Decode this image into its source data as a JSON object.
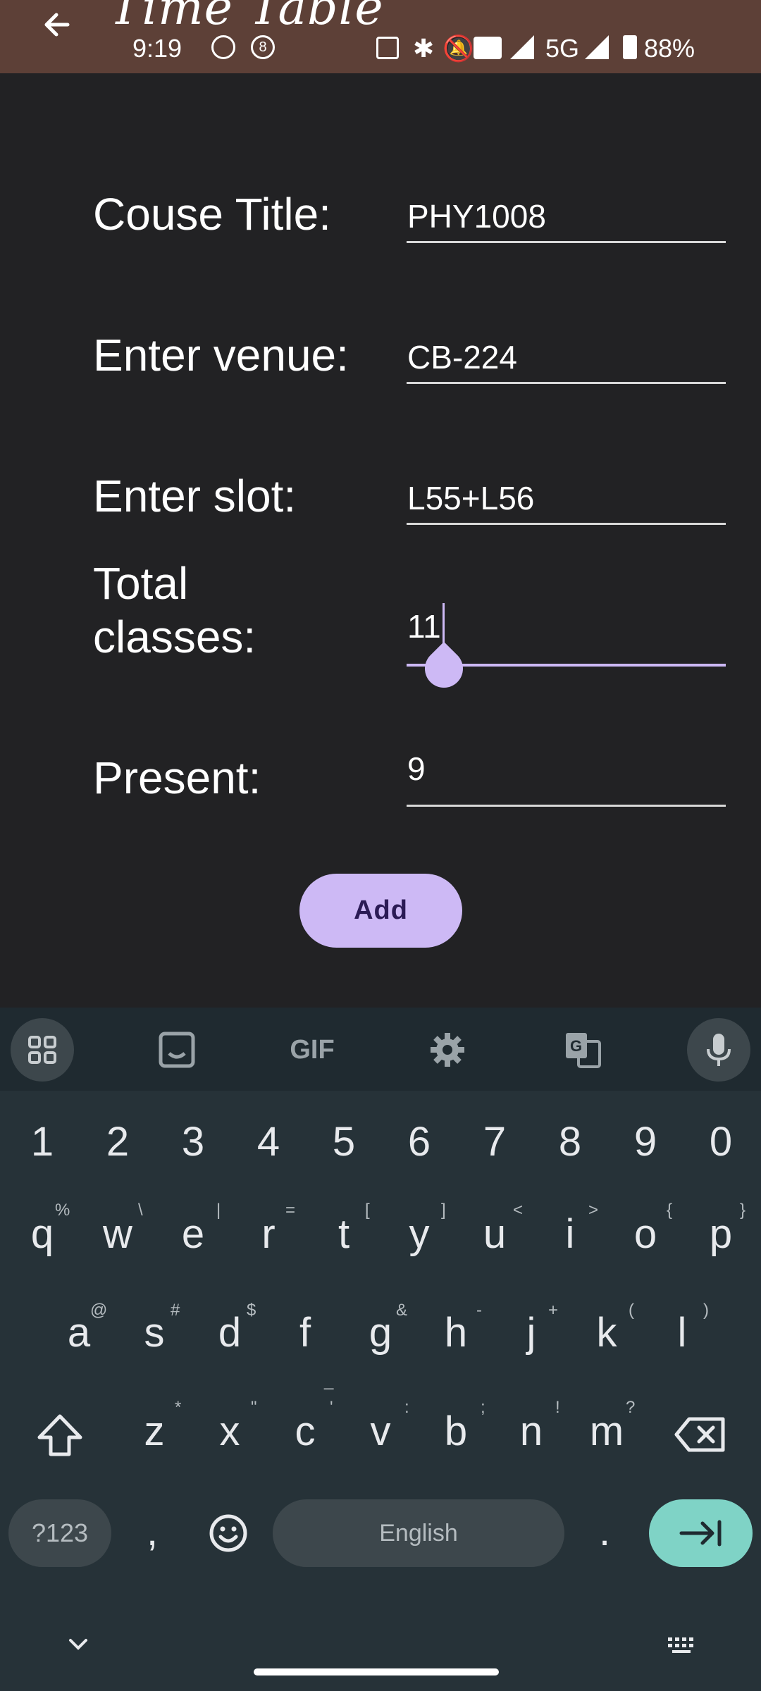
{
  "status_bar": {
    "time": "9:19",
    "network": "5G",
    "battery": "88%"
  },
  "app_bar": {
    "title": "Time Table",
    "back_icon": "arrow-back-icon"
  },
  "form": {
    "course_title_label": "Couse Title:",
    "course_title_value": "PHY1008",
    "venue_label": "Enter venue:",
    "venue_value": "CB-224",
    "slot_label": "Enter slot:",
    "slot_value": "L55+L56",
    "total_label_line1": "Total",
    "total_label_line2": "classes:",
    "total_value": "11",
    "present_label": "Present:",
    "present_value": "9",
    "add_button": "Add"
  },
  "keyboard": {
    "toolbar_icons": [
      "apps-grid-icon",
      "sticker-icon",
      "gif-icon",
      "gear-icon",
      "translate-icon",
      "mic-icon"
    ],
    "gif_label": "GIF",
    "number_row": [
      "1",
      "2",
      "3",
      "4",
      "5",
      "6",
      "7",
      "8",
      "9",
      "0"
    ],
    "row1": [
      "q",
      "w",
      "e",
      "r",
      "t",
      "y",
      "u",
      "i",
      "o",
      "p"
    ],
    "row1_hints": [
      "%",
      "\\",
      "|",
      "=",
      "[",
      "]",
      "<",
      ">",
      "{",
      "}"
    ],
    "row2": [
      "a",
      "s",
      "d",
      "f",
      "g",
      "h",
      "j",
      "k",
      "l"
    ],
    "row2_hints": [
      "@",
      "#",
      "$",
      "_",
      "&",
      "-",
      "+",
      "(",
      ")"
    ],
    "row3": [
      "z",
      "x",
      "c",
      "v",
      "b",
      "n",
      "m"
    ],
    "row3_hints": [
      "*",
      "\"",
      "'",
      ":",
      ";",
      "!",
      "?"
    ],
    "symbols_key": "?123",
    "comma_key": ",",
    "space_label": "English",
    "period_key": ".",
    "accent_color": "#7fd3c6"
  }
}
